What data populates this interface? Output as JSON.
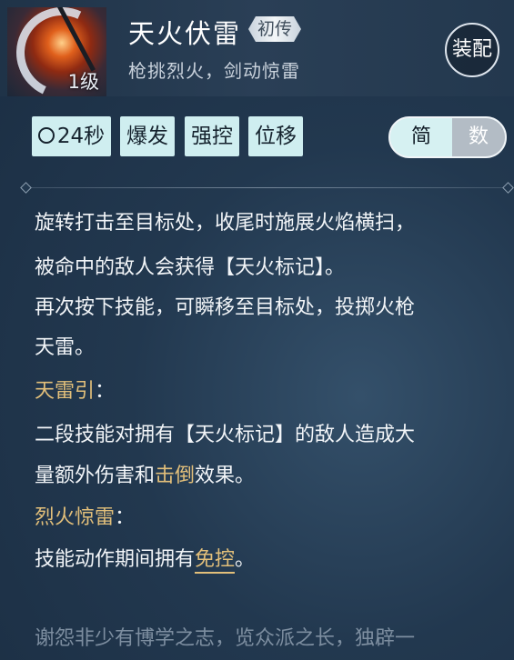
{
  "skill": {
    "level": "1级",
    "name": "天火伏雷",
    "rank": "初传",
    "subtitle": "枪挑烈火，剑动惊雷",
    "equip_label": "装配"
  },
  "tags": {
    "cooldown": "24秒",
    "items": [
      "爆发",
      "强控",
      "位移"
    ]
  },
  "mode": {
    "simple": "简",
    "detail": "数",
    "selected": "简"
  },
  "description": {
    "line1": "旋转打击至目标处，收尾时施展火焰横扫，",
    "line2": "被命中的敌人会获得【天火标记】。",
    "line3": "再次按下技能，可瞬移至目标处，投掷火枪",
    "line4": "天雷。",
    "effect1_title": "天雷引",
    "effect1_colon": "：",
    "effect1_line1": "二段技能对拥有【天火标记】的敌人造成大",
    "effect1_line2a": "量额外伤害和",
    "effect1_keyword": "击倒",
    "effect1_line2b": "效果。",
    "effect2_title": "烈火惊雷",
    "effect2_colon": "：",
    "effect2_line1a": "技能动作期间拥有",
    "effect2_keyword": "免控",
    "effect2_line1b": "。"
  },
  "lore": "谢怨非少有博学之志，览众派之长，独辟一",
  "colors": {
    "tag_bg": "#cfeef0",
    "keyword_gold": "#e2bf7a",
    "background": "#22384f"
  },
  "icons": [
    "skill-fire-spear-icon",
    "clock-icon"
  ]
}
